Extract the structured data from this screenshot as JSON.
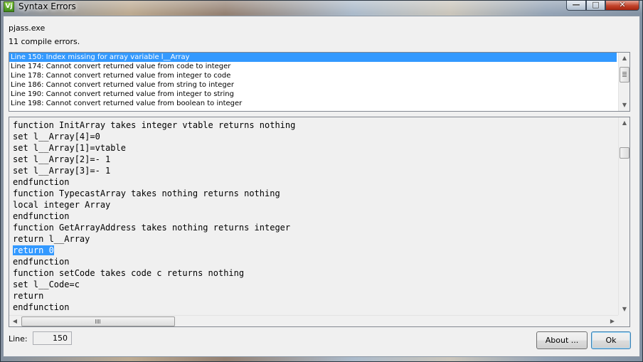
{
  "window": {
    "title": "Syntax Errors",
    "app_icon_glyph": "Vj",
    "controls": {
      "minimize": "—",
      "maximize": "□",
      "close": "✕"
    }
  },
  "header": {
    "exe": "pjass.exe",
    "count": "11 compile errors."
  },
  "errors": [
    "Line 150:  Index missing for array variable l__Array",
    "Line 174:  Cannot convert returned value from code to integer",
    "Line 178:  Cannot convert returned value from integer to code",
    "Line 186:  Cannot convert returned value from string to integer",
    "Line 190:  Cannot convert returned value from integer to string",
    "Line 198:  Cannot convert returned value from boolean to integer"
  ],
  "selected_error_index": 0,
  "code": {
    "lines": [
      "function InitArray takes integer vtable returns nothing",
      "set l__Array[4]=0",
      "set l__Array[1]=vtable",
      "set l__Array[2]=- 1",
      "set l__Array[3]=- 1",
      "endfunction",
      "function TypecastArray takes nothing returns nothing",
      "local integer Array",
      "endfunction",
      "function GetArrayAddress takes nothing returns integer",
      "return l__Array",
      "return 0",
      "endfunction",
      "function setCode takes code c returns nothing",
      "set l__Code=c",
      "return",
      "endfunction"
    ],
    "highlighted_line_index": 11
  },
  "footer": {
    "line_label": "Line:",
    "line_value": "150",
    "about_label": "About ...",
    "ok_label": "Ok"
  },
  "icons": {
    "scroll_up": "▲",
    "scroll_down": "▼",
    "scroll_left": "◀",
    "scroll_right": "▶"
  },
  "colors": {
    "selection": "#3399ff",
    "client_bg": "#f0f0f0"
  }
}
